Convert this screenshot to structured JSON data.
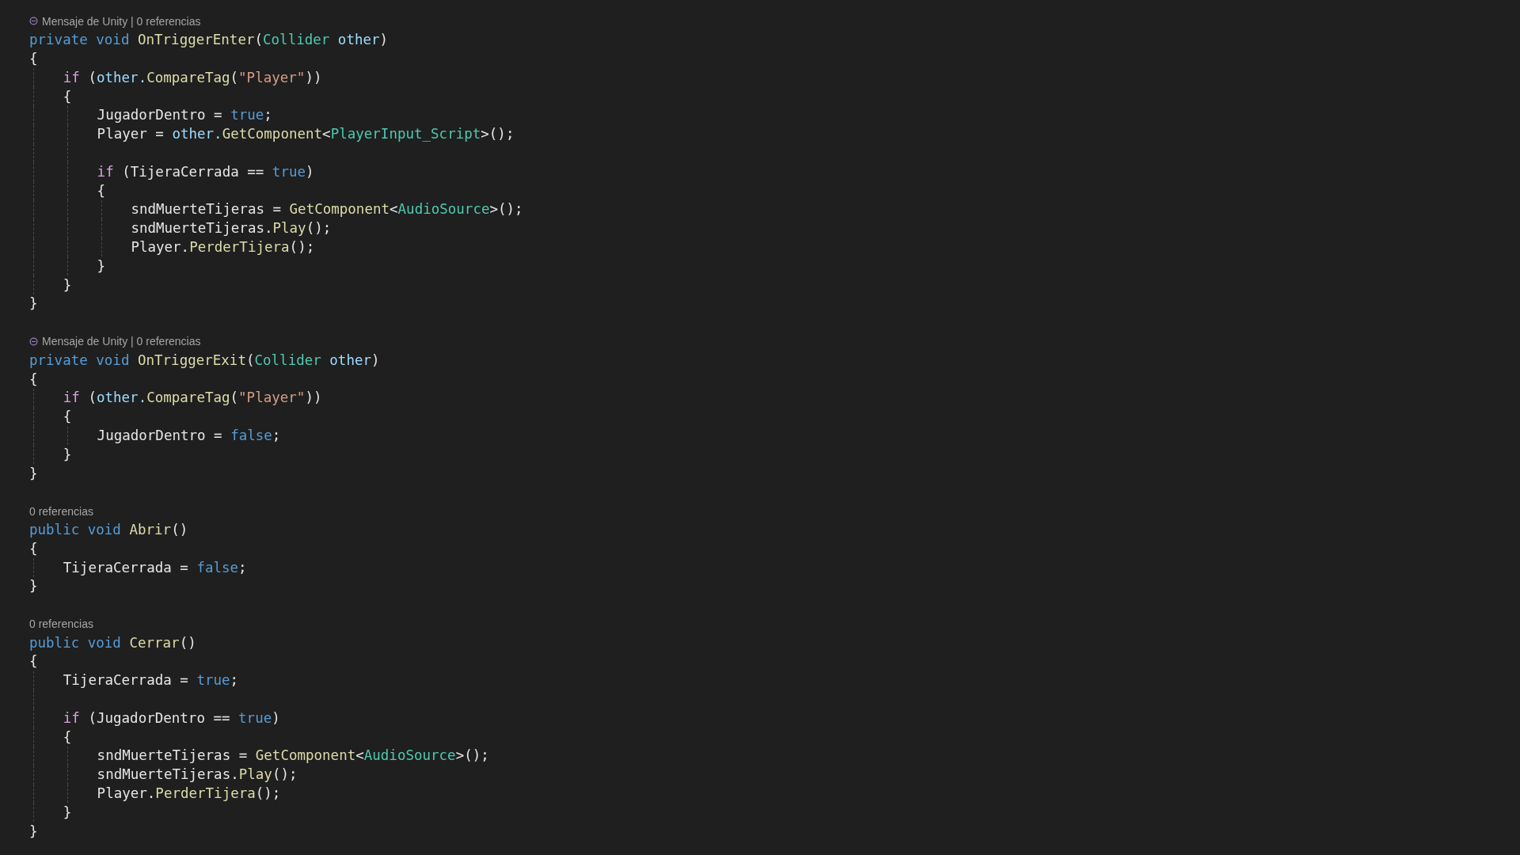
{
  "editor": {
    "lines": [
      {
        "kind": "hint",
        "has_icon": true,
        "text": "Mensaje de Unity | 0 referencias"
      },
      {
        "kind": "code",
        "tokens": [
          {
            "kind": "keyword",
            "text": "private void"
          },
          {
            "kind": "method",
            "text": " OnTriggerEnter"
          },
          {
            "kind": "plain",
            "text": "("
          },
          {
            "kind": "type",
            "text": "Collider"
          },
          {
            "kind": "param",
            "text": " other"
          },
          {
            "kind": "plain",
            "text": ")"
          }
        ]
      },
      {
        "kind": "code",
        "tokens": [
          {
            "kind": "plain",
            "text": "{"
          }
        ]
      },
      {
        "kind": "block",
        "children": [
          {
            "kind": "code",
            "tokens": [
              {
                "kind": "control",
                "text": "if"
              },
              {
                "kind": "plain",
                "text": " ("
              },
              {
                "kind": "param",
                "text": "other."
              },
              {
                "kind": "method",
                "text": "CompareTag"
              },
              {
                "kind": "plain",
                "text": "("
              },
              {
                "kind": "string",
                "text": "\"Player\""
              },
              {
                "kind": "plain",
                "text": "))"
              }
            ]
          },
          {
            "kind": "code",
            "tokens": [
              {
                "kind": "plain",
                "text": "{"
              }
            ]
          },
          {
            "kind": "block",
            "children": [
              {
                "kind": "code",
                "tokens": [
                  {
                    "kind": "plain",
                    "text": "JugadorDentro ="
                  },
                  {
                    "kind": "keyword",
                    "text": " true"
                  },
                  {
                    "kind": "plain",
                    "text": ";"
                  }
                ]
              },
              {
                "kind": "code",
                "tokens": [
                  {
                    "kind": "plain",
                    "text": "Player ="
                  },
                  {
                    "kind": "param",
                    "text": " other."
                  },
                  {
                    "kind": "method",
                    "text": "GetComponent"
                  },
                  {
                    "kind": "plain",
                    "text": "<"
                  },
                  {
                    "kind": "type",
                    "text": "PlayerInput_Script"
                  },
                  {
                    "kind": "plain",
                    "text": ">();"
                  }
                ]
              },
              {
                "kind": "blank"
              },
              {
                "kind": "code",
                "tokens": [
                  {
                    "kind": "control",
                    "text": "if"
                  },
                  {
                    "kind": "plain",
                    "text": " (TijeraCerrada =="
                  },
                  {
                    "kind": "keyword",
                    "text": " true"
                  },
                  {
                    "kind": "plain",
                    "text": ")"
                  }
                ]
              },
              {
                "kind": "code",
                "tokens": [
                  {
                    "kind": "plain",
                    "text": "{"
                  }
                ]
              },
              {
                "kind": "block",
                "children": [
                  {
                    "kind": "code",
                    "tokens": [
                      {
                        "kind": "plain",
                        "text": "sndMuerteTijeras ="
                      },
                      {
                        "kind": "method",
                        "text": " GetComponent"
                      },
                      {
                        "kind": "plain",
                        "text": "<"
                      },
                      {
                        "kind": "type",
                        "text": "AudioSource"
                      },
                      {
                        "kind": "plain",
                        "text": ">();"
                      }
                    ]
                  },
                  {
                    "kind": "code",
                    "tokens": [
                      {
                        "kind": "plain",
                        "text": "sndMuerteTijeras."
                      },
                      {
                        "kind": "method",
                        "text": "Play"
                      },
                      {
                        "kind": "plain",
                        "text": "();"
                      }
                    ]
                  },
                  {
                    "kind": "code",
                    "tokens": [
                      {
                        "kind": "plain",
                        "text": "Player."
                      },
                      {
                        "kind": "method",
                        "text": "PerderTijera"
                      },
                      {
                        "kind": "plain",
                        "text": "();"
                      }
                    ]
                  }
                ]
              },
              {
                "kind": "code",
                "tokens": [
                  {
                    "kind": "plain",
                    "text": "}"
                  }
                ]
              }
            ]
          },
          {
            "kind": "code",
            "tokens": [
              {
                "kind": "plain",
                "text": "}"
              }
            ]
          }
        ]
      },
      {
        "kind": "code",
        "tokens": [
          {
            "kind": "plain",
            "text": "}"
          }
        ]
      },
      {
        "kind": "blank"
      },
      {
        "kind": "hint",
        "has_icon": true,
        "text": "Mensaje de Unity | 0 referencias"
      },
      {
        "kind": "code",
        "tokens": [
          {
            "kind": "keyword",
            "text": "private void"
          },
          {
            "kind": "method",
            "text": " OnTriggerExit"
          },
          {
            "kind": "plain",
            "text": "("
          },
          {
            "kind": "type",
            "text": "Collider"
          },
          {
            "kind": "param",
            "text": " other"
          },
          {
            "kind": "plain",
            "text": ")"
          }
        ]
      },
      {
        "kind": "code",
        "tokens": [
          {
            "kind": "plain",
            "text": "{"
          }
        ]
      },
      {
        "kind": "block",
        "children": [
          {
            "kind": "code",
            "tokens": [
              {
                "kind": "control",
                "text": "if"
              },
              {
                "kind": "plain",
                "text": " ("
              },
              {
                "kind": "param",
                "text": "other."
              },
              {
                "kind": "method",
                "text": "CompareTag"
              },
              {
                "kind": "plain",
                "text": "("
              },
              {
                "kind": "string",
                "text": "\"Player\""
              },
              {
                "kind": "plain",
                "text": "))"
              }
            ]
          },
          {
            "kind": "code",
            "tokens": [
              {
                "kind": "plain",
                "text": "{"
              }
            ]
          },
          {
            "kind": "block",
            "children": [
              {
                "kind": "code",
                "tokens": [
                  {
                    "kind": "plain",
                    "text": "JugadorDentro ="
                  },
                  {
                    "kind": "keyword",
                    "text": " false"
                  },
                  {
                    "kind": "plain",
                    "text": ";"
                  }
                ]
              }
            ]
          },
          {
            "kind": "code",
            "tokens": [
              {
                "kind": "plain",
                "text": "}"
              }
            ]
          }
        ]
      },
      {
        "kind": "code",
        "tokens": [
          {
            "kind": "plain",
            "text": "}"
          }
        ]
      },
      {
        "kind": "blank"
      },
      {
        "kind": "hint",
        "has_icon": false,
        "text": "0 referencias"
      },
      {
        "kind": "code",
        "tokens": [
          {
            "kind": "keyword",
            "text": "public void"
          },
          {
            "kind": "method",
            "text": " Abrir"
          },
          {
            "kind": "plain",
            "text": "()"
          }
        ]
      },
      {
        "kind": "code",
        "tokens": [
          {
            "kind": "plain",
            "text": "{"
          }
        ]
      },
      {
        "kind": "block",
        "children": [
          {
            "kind": "code",
            "tokens": [
              {
                "kind": "plain",
                "text": "TijeraCerrada ="
              },
              {
                "kind": "keyword",
                "text": " false"
              },
              {
                "kind": "plain",
                "text": ";"
              }
            ]
          }
        ]
      },
      {
        "kind": "code",
        "tokens": [
          {
            "kind": "plain",
            "text": "}"
          }
        ]
      },
      {
        "kind": "blank"
      },
      {
        "kind": "hint",
        "has_icon": false,
        "text": "0 referencias"
      },
      {
        "kind": "code",
        "tokens": [
          {
            "kind": "keyword",
            "text": "public void"
          },
          {
            "kind": "method",
            "text": " Cerrar"
          },
          {
            "kind": "plain",
            "text": "()"
          }
        ]
      },
      {
        "kind": "code",
        "tokens": [
          {
            "kind": "plain",
            "text": "{"
          }
        ]
      },
      {
        "kind": "block",
        "children": [
          {
            "kind": "code",
            "tokens": [
              {
                "kind": "plain",
                "text": "TijeraCerrada ="
              },
              {
                "kind": "keyword",
                "text": " true"
              },
              {
                "kind": "plain",
                "text": ";"
              }
            ]
          },
          {
            "kind": "blank"
          },
          {
            "kind": "code",
            "tokens": [
              {
                "kind": "control",
                "text": "if"
              },
              {
                "kind": "plain",
                "text": " (JugadorDentro =="
              },
              {
                "kind": "keyword",
                "text": " true"
              },
              {
                "kind": "plain",
                "text": ")"
              }
            ]
          },
          {
            "kind": "code",
            "tokens": [
              {
                "kind": "plain",
                "text": "{"
              }
            ]
          },
          {
            "kind": "block",
            "children": [
              {
                "kind": "code",
                "tokens": [
                  {
                    "kind": "plain",
                    "text": "sndMuerteTijeras ="
                  },
                  {
                    "kind": "method",
                    "text": " GetComponent"
                  },
                  {
                    "kind": "plain",
                    "text": "<"
                  },
                  {
                    "kind": "type",
                    "text": "AudioSource"
                  },
                  {
                    "kind": "plain",
                    "text": ">();"
                  }
                ]
              },
              {
                "kind": "code",
                "tokens": [
                  {
                    "kind": "plain",
                    "text": "sndMuerteTijeras."
                  },
                  {
                    "kind": "method",
                    "text": "Play"
                  },
                  {
                    "kind": "plain",
                    "text": "();"
                  }
                ]
              },
              {
                "kind": "code",
                "tokens": [
                  {
                    "kind": "plain",
                    "text": "Player."
                  },
                  {
                    "kind": "method",
                    "text": "PerderTijera"
                  },
                  {
                    "kind": "plain",
                    "text": "();"
                  }
                ]
              }
            ]
          },
          {
            "kind": "code",
            "tokens": [
              {
                "kind": "plain",
                "text": "}"
              }
            ]
          }
        ]
      },
      {
        "kind": "code",
        "tokens": [
          {
            "kind": "plain",
            "text": "}"
          }
        ]
      }
    ]
  }
}
